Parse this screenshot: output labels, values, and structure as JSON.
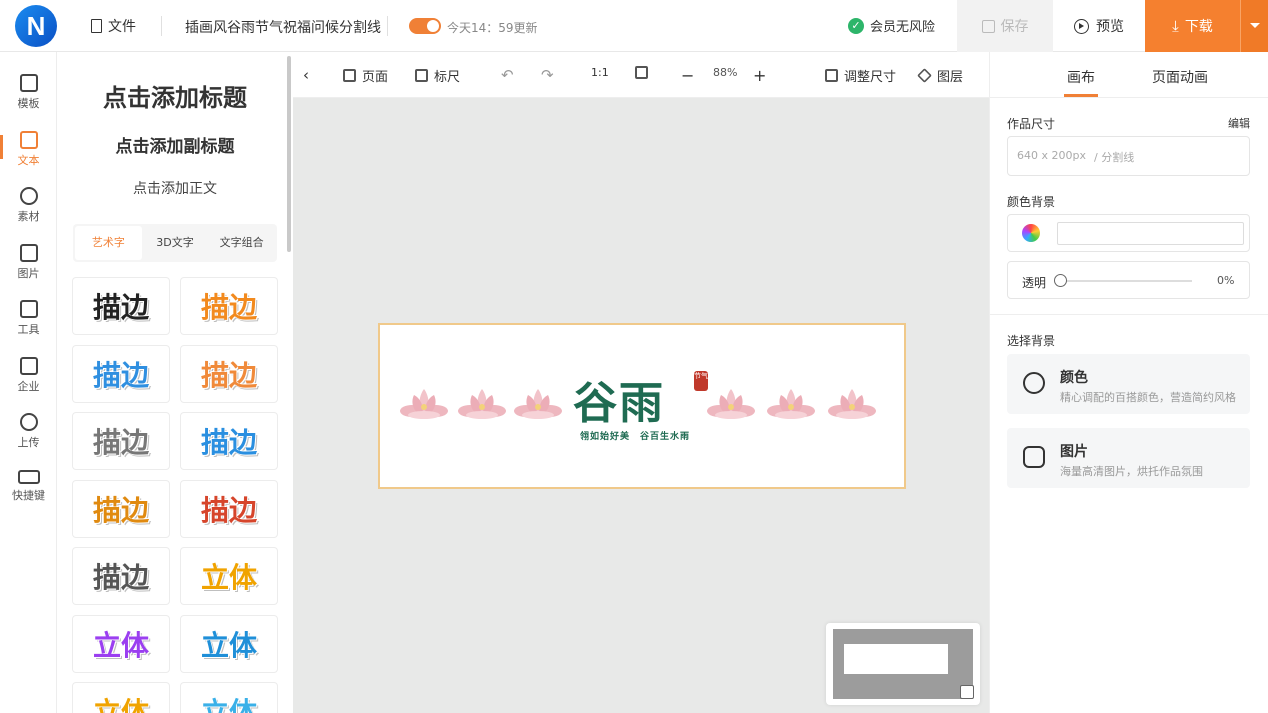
{
  "header": {
    "logo": "N",
    "file_label": "文件",
    "doc_title": "插画风谷雨节气祝福问候分割线",
    "save_status": "今天14：59更新",
    "member_label": "会员无风险",
    "save_label": "保存",
    "preview_label": "预览",
    "download_label": "下载"
  },
  "rail": {
    "items": [
      {
        "label": "模板",
        "icon": "shirt-icon"
      },
      {
        "label": "文本",
        "icon": "text-icon"
      },
      {
        "label": "素材",
        "icon": "shapes-icon"
      },
      {
        "label": "图片",
        "icon": "image-icon"
      },
      {
        "label": "工具",
        "icon": "toolbox-icon"
      },
      {
        "label": "企业",
        "icon": "building-icon"
      },
      {
        "label": "上传",
        "icon": "cloud-upload-icon"
      },
      {
        "label": "快捷键",
        "icon": "keyboard-icon"
      }
    ],
    "active": "文本"
  },
  "panel": {
    "add_title": "点击添加标题",
    "add_subtitle": "点击添加副标题",
    "add_body": "点击添加正文",
    "tabs": [
      "艺术字",
      "3D文字",
      "文字组合"
    ],
    "active_tab": "艺术字",
    "presets": [
      {
        "text": "描边",
        "color": "#222222"
      },
      {
        "text": "描边",
        "color": "#f28a1e"
      },
      {
        "text": "描边",
        "color": "#2f8fe0"
      },
      {
        "text": "描边",
        "color": "#f08a3a"
      },
      {
        "text": "描边",
        "color": "#777777"
      },
      {
        "text": "描边",
        "color": "#2a8fe0"
      },
      {
        "text": "描边",
        "color": "#e08a10"
      },
      {
        "text": "描边",
        "color": "#d6452b"
      },
      {
        "text": "描边",
        "color": "#555555"
      },
      {
        "text": "立体",
        "color": "#f0a300"
      },
      {
        "text": "立体",
        "color": "#9b3ff0"
      },
      {
        "text": "立体",
        "color": "#1f8fd8"
      },
      {
        "text": "立体",
        "color": "#f0a300"
      },
      {
        "text": "立体",
        "color": "#3ab0e8"
      }
    ]
  },
  "toolbar": {
    "page_label": "页面",
    "ruler_label": "标尺",
    "ratio_label": "1:1",
    "zoom": "88%",
    "resize_label": "调整尺寸",
    "layers_label": "图层"
  },
  "artboard": {
    "title": "谷雨",
    "seal": "节气",
    "subtitle": "翎如始好美　谷百生水雨",
    "lotus_count": 6
  },
  "right_panel": {
    "tabs": [
      "画布",
      "页面动画"
    ],
    "active_tab": "画布",
    "size_label": "作品尺寸",
    "edit_label": "编辑",
    "size_value": "640 x 200px",
    "size_type": "/ 分割线",
    "color_bg_label": "颜色背景",
    "opacity_label": "透明",
    "opacity_value": "0%",
    "choose_bg_label": "选择背景",
    "bg_options": [
      {
        "title": "颜色",
        "desc": "精心调配的百搭颜色，营造简约风格"
      },
      {
        "title": "图片",
        "desc": "海量高清图片，烘托作品氛围"
      }
    ]
  },
  "colors": {
    "accent": "#f5802f",
    "brand": "#1b8cf0",
    "title_green": "#1f6b52"
  }
}
